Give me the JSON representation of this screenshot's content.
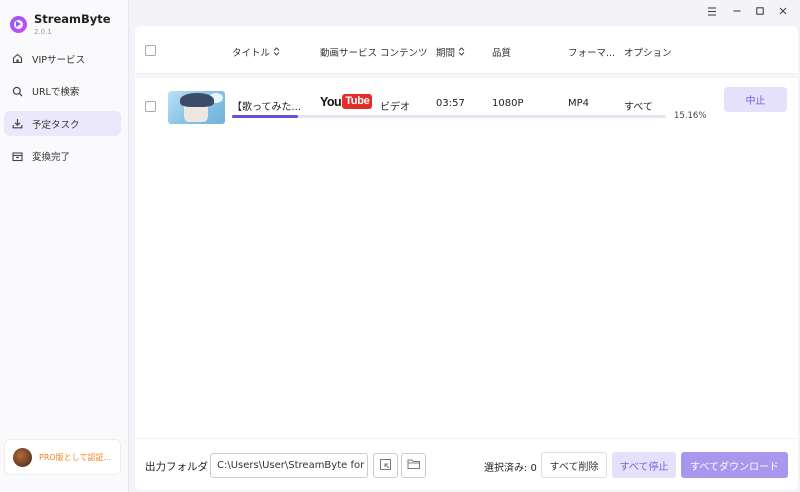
{
  "app": {
    "name": "StreamByte",
    "version": "2.0.1"
  },
  "sidebar": {
    "items": [
      {
        "label": "VIPサービス",
        "icon": "home-icon",
        "active": false
      },
      {
        "label": "URLで検索",
        "icon": "search-icon",
        "active": false
      },
      {
        "label": "予定タスク",
        "icon": "download-icon",
        "active": true
      },
      {
        "label": "変換完了",
        "icon": "archive-icon",
        "active": false
      }
    ],
    "pro_text": "PRO版として認証..."
  },
  "table": {
    "headers": {
      "title": "タイトル",
      "service": "動画サービス",
      "content": "コンテンツ",
      "duration": "期間",
      "quality": "品質",
      "format": "フォーマ...",
      "option": "オプション"
    },
    "rows": [
      {
        "title": "【歌ってみた...",
        "service": "YouTube",
        "content": "ビデオ",
        "duration": "03:57",
        "quality": "1080P",
        "format": "MP4",
        "option": "すべて",
        "progress": 15.16,
        "progress_text": "15.16%",
        "action": "中止"
      }
    ]
  },
  "footer": {
    "output_label": "出力フォルダ",
    "output_path": "C:\\Users\\User\\StreamByte for",
    "selected_text": "選択済み: 0",
    "delete_all": "すべて削除",
    "stop_all": "すべて停止",
    "download_all": "すべてダウンロード"
  },
  "youtube": {
    "you": "You",
    "tube": "Tube"
  },
  "colors": {
    "accent": "#6a4cd9",
    "accent_soft": "#e6e1fb",
    "pro": "#f07f1a",
    "youtube_red": "#e52d27"
  }
}
